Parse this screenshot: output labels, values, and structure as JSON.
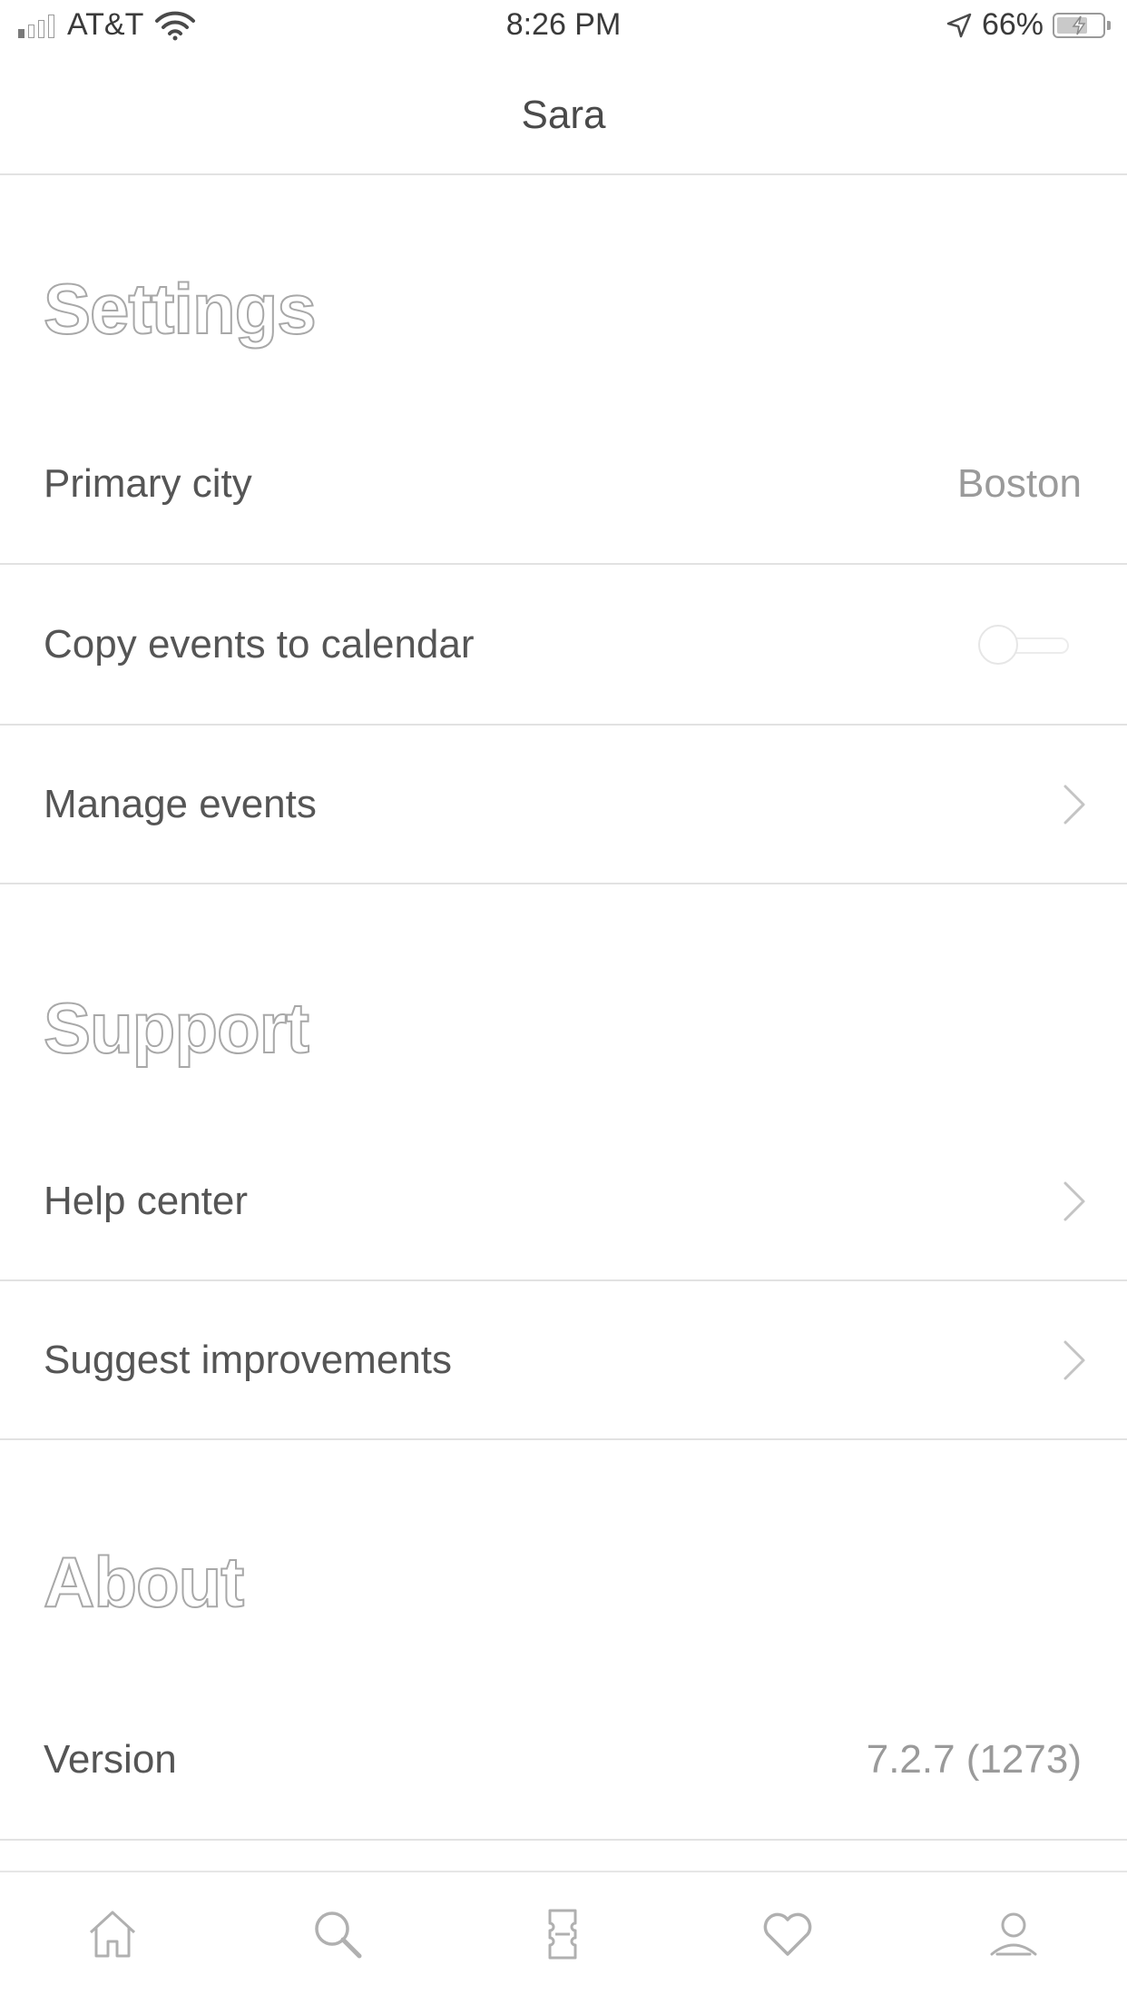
{
  "status_bar": {
    "carrier": "AT&T",
    "time": "8:26 PM",
    "battery": "66%",
    "battery_level": 0.66
  },
  "header": {
    "title": "Sara"
  },
  "settings": {
    "title": "Settings",
    "rows": [
      {
        "label": "Primary city",
        "value": "Boston"
      },
      {
        "label": "Copy events to calendar",
        "toggle_on": false
      },
      {
        "label": "Manage events"
      }
    ]
  },
  "support": {
    "title": "Support",
    "rows": [
      {
        "label": "Help center"
      },
      {
        "label": "Suggest improvements"
      }
    ]
  },
  "about": {
    "title": "About",
    "rows": [
      {
        "label": "Version",
        "value": "7.2.7 (1273)"
      }
    ]
  },
  "tab_bar": {
    "tabs": [
      {
        "icon": "home-icon"
      },
      {
        "icon": "search-icon"
      },
      {
        "icon": "ticket-icon"
      },
      {
        "icon": "heart-icon"
      },
      {
        "icon": "profile-icon"
      }
    ]
  },
  "colors": {
    "divider": "#e2e2e2",
    "text": "#555555",
    "muted": "#9a9a9a"
  }
}
